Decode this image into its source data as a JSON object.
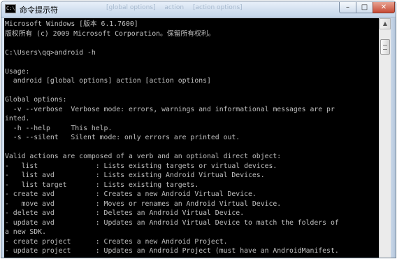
{
  "window": {
    "title": "命令提示符",
    "icon": "cmd-icon",
    "icon_glyph": "C:\\",
    "ghost_tabs": [
      "[global options]",
      "action",
      "[action options]"
    ],
    "controls": {
      "minimize": "–",
      "maximize": "□",
      "close": "✕"
    }
  },
  "console": {
    "lines": [
      "Microsoft Windows [版本 6.1.7600]",
      "版权所有 (c) 2009 Microsoft Corporation。保留所有权利。",
      "",
      "C:\\Users\\qq>android -h",
      "",
      "Usage:",
      "  android [global options] action [action options]",
      "",
      "Global options:",
      "  -v --verbose  Verbose mode: errors, warnings and informational messages are pr",
      "inted.",
      "  -h --help     This help.",
      "  -s --silent   Silent mode: only errors are printed out.",
      "",
      "Valid actions are composed of a verb and an optional direct object:",
      "-   list              : Lists existing targets or virtual devices.",
      "-   list avd          : Lists existing Android Virtual Devices.",
      "-   list target       : Lists existing targets.",
      "- create avd          : Creates a new Android Virtual Device.",
      "-   move avd          : Moves or renames an Android Virtual Device.",
      "- delete avd          : Deletes an Android Virtual Device.",
      "- update avd          : Updates an Android Virtual Device to match the folders of",
      "a new SDK.",
      "- create project      : Creates a new Android Project.",
      "- update project      : Updates an Android Project (must have an AndroidManifest."
    ]
  },
  "scrollbar": {
    "up_arrow": "▲"
  },
  "colors": {
    "console_bg": "#000000",
    "console_fg": "#c0c0c0"
  }
}
